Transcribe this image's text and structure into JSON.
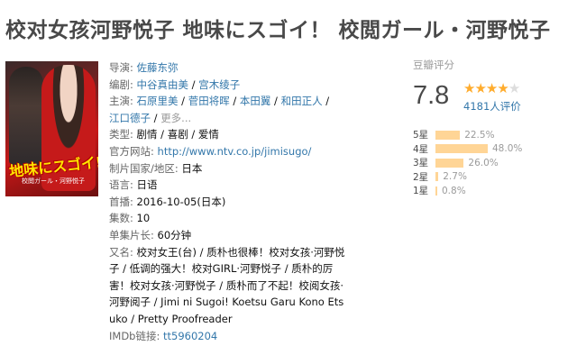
{
  "title": "校对女孩河野悦子 地味にスゴイ！ 校閲ガール・河野悦子",
  "poster": {
    "title_text": "地味にスゴイ!",
    "subtitle_text": "校閲ガール・河野悦子"
  },
  "info": {
    "director_label": "导演:",
    "director": "佐藤东弥",
    "writer_label": "编剧:",
    "writers": [
      "中谷真由美",
      "宫木绫子"
    ],
    "cast_label": "主演:",
    "cast": [
      "石原里美",
      "菅田将晖",
      "本田翼",
      "和田正人",
      "江口德子"
    ],
    "cast_more": "更多...",
    "genre_label": "类型:",
    "genre": "剧情 / 喜剧 / 爱情",
    "site_label": "官方网站:",
    "site": "http://www.ntv.co.jp/jimisugo/",
    "country_label": "制片国家/地区:",
    "country": "日本",
    "language_label": "语言:",
    "language": "日语",
    "premiere_label": "首播:",
    "premiere": "2016-10-05(日本)",
    "episodes_label": "集数:",
    "episodes": "10",
    "runtime_label": "单集片长:",
    "runtime": "60分钟",
    "aka_label": "又名:",
    "aka": "校对女王(台) / 质朴也很棒！校对女孩·河野悦子 / 低调的强大！校对GIRL·河野悦子 / 质朴的厉害！校对女孩·河野悦子 / 质朴而了不起！校阅女孩·河野阅子 / Jimi ni Sugoi! Koetsu Garu Kono Etsuko / Pretty Proofreader",
    "imdb_label": "IMDb链接:",
    "imdb": "tt5960204"
  },
  "rating": {
    "header": "豆瓣评分",
    "score": "7.8",
    "stars_filled": 4,
    "stars_total": 5,
    "votes": "4181人评价",
    "distribution": [
      {
        "label": "5星",
        "percent": 22.5,
        "text": "22.5%"
      },
      {
        "label": "4星",
        "percent": 48.0,
        "text": "48.0%"
      },
      {
        "label": "3星",
        "percent": 26.0,
        "text": "26.0%"
      },
      {
        "label": "2星",
        "percent": 2.7,
        "text": "2.7%"
      },
      {
        "label": "1星",
        "percent": 0.8,
        "text": "0.8%"
      }
    ]
  },
  "colors": {
    "link": "#3377aa",
    "star": "#ffac2d",
    "bar": "#ffd596"
  }
}
